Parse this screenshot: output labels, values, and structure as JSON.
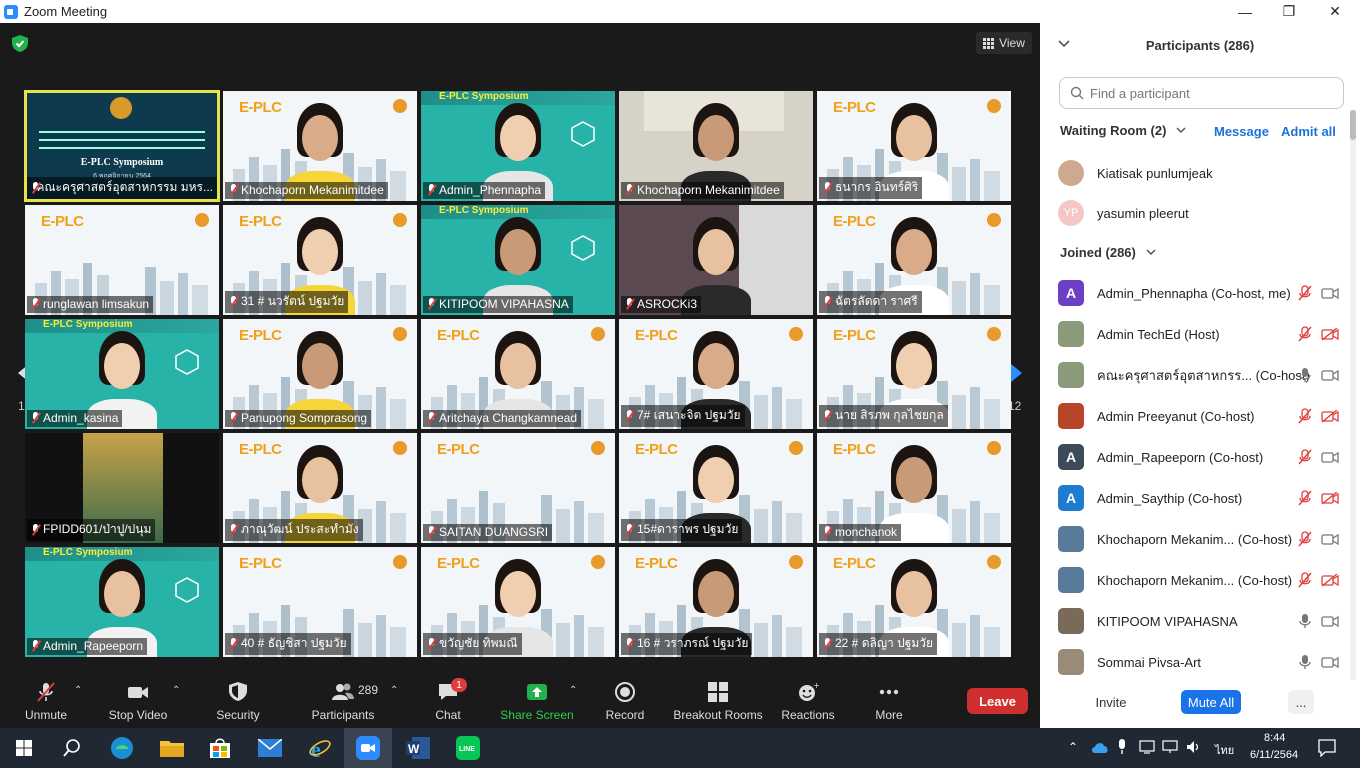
{
  "window": {
    "title": "Zoom Meeting",
    "minimize": "—",
    "maximize": "❐",
    "close": "✕"
  },
  "view_button": {
    "label": "View"
  },
  "grid": {
    "page_left": "1/12",
    "page_right": "1/12",
    "tiles": [
      {
        "name": "คณะครุศาสตร์อุตสาหกรรม มหร..."
      },
      {
        "name": "Khochaporn Mekanimitdee"
      },
      {
        "name": "Admin_Phennapha"
      },
      {
        "name": "Khochaporn Mekanimitdee"
      },
      {
        "name": "ธนากร อินทร์ศิริ"
      },
      {
        "name": "runglawan limsakun"
      },
      {
        "name": "31 # นวรัตน์ ปฐมวัย"
      },
      {
        "name": "KITIPOOM VIPAHASNA"
      },
      {
        "name": "ASROCKi3"
      },
      {
        "name": "ฉัตรลัดดา ราศรี"
      },
      {
        "name": "Admin_kasina"
      },
      {
        "name": "Panupong Somprasong"
      },
      {
        "name": "Aritchaya Changkamnead"
      },
      {
        "name": "7# เสนาะจิต ปฐมวัย"
      },
      {
        "name": "นาย สิรภพ กุลไชยกุล"
      },
      {
        "name": "FPIDD601/ป่าปู/ปนุม"
      },
      {
        "name": "ภาณุวัฒน์ ประสะทำมัง"
      },
      {
        "name": "SAITAN DUANGSRI"
      },
      {
        "name": "15#ดาราพร ปฐมวัย"
      },
      {
        "name": "monchanok"
      },
      {
        "name": "Admin_Rapeeporn"
      },
      {
        "name": "40 # ธัญชิสา ปฐมวัย"
      },
      {
        "name": "ขวัญชัย ทิพมณี"
      },
      {
        "name": "16 # วราภรณ์ ปฐมวัย"
      },
      {
        "name": "22 # ดลิญา ปฐมวัย"
      }
    ],
    "slide_title_1": "E-PLC Symposium",
    "slide_date_1": "6 พฤศจิกายน 2564",
    "slide_brand": "E-PLC",
    "slide_header_teal": "E-PLC Symposium"
  },
  "toolbar": {
    "unmute": "Unmute",
    "stop_video": "Stop Video",
    "security": "Security",
    "participants": "Participants",
    "participants_count": "289",
    "chat": "Chat",
    "chat_badge": "1",
    "share_screen": "Share Screen",
    "record": "Record",
    "breakout": "Breakout Rooms",
    "reactions": "Reactions",
    "more": "More",
    "leave": "Leave"
  },
  "panel": {
    "title": "Participants (286)",
    "search_placeholder": "Find a participant",
    "waiting_room": "Waiting Room (2)",
    "message": "Message",
    "admit_all": "Admit all",
    "waiting": [
      {
        "name": "Kiatisak punlumjeak",
        "initials": ""
      },
      {
        "name": "yasumin pleerut",
        "initials": "YP"
      }
    ],
    "joined_label": "Joined (286)",
    "joined": [
      {
        "name": "Admin_Phennapha (Co-host, me)",
        "initials": "A",
        "color": "#6c3fc5",
        "mic": "muted",
        "cam": "on"
      },
      {
        "name": "Admin TechEd (Host)",
        "initials": "",
        "color": "#8a9a7a",
        "mic": "muted",
        "cam": "off"
      },
      {
        "name": "คณะครุศาสตร์อุตสาหกรร...  (Co-host)",
        "initials": "",
        "color": "#8a9a7a",
        "mic": "on",
        "cam": "on"
      },
      {
        "name": "Admin Preeyanut (Co-host)",
        "initials": "",
        "color": "#b8442a",
        "mic": "muted",
        "cam": "off"
      },
      {
        "name": "Admin_Rapeeporn (Co-host)",
        "initials": "A",
        "color": "#3d4a5a",
        "mic": "muted",
        "cam": "on"
      },
      {
        "name": "Admin_Saythip (Co-host)",
        "initials": "A",
        "color": "#1f7bd0",
        "mic": "muted",
        "cam": "off"
      },
      {
        "name": "Khochaporn Mekanim... (Co-host)",
        "initials": "",
        "color": "#5a7a9a",
        "mic": "muted",
        "cam": "on"
      },
      {
        "name": "Khochaporn Mekanim... (Co-host)",
        "initials": "",
        "color": "#5a7a9a",
        "mic": "muted",
        "cam": "off"
      },
      {
        "name": "KITIPOOM VIPAHASNA",
        "initials": "",
        "color": "#7a6a5a",
        "mic": "on",
        "cam": "on"
      },
      {
        "name": "Sommai Pivsa-Art",
        "initials": "",
        "color": "#9a8a7a",
        "mic": "on",
        "cam": "on"
      }
    ],
    "invite": "Invite",
    "mute_all": "Mute All",
    "more": "..."
  },
  "taskbar": {
    "lang": "ไทย",
    "time": "8:44",
    "date": "6/11/2564"
  }
}
